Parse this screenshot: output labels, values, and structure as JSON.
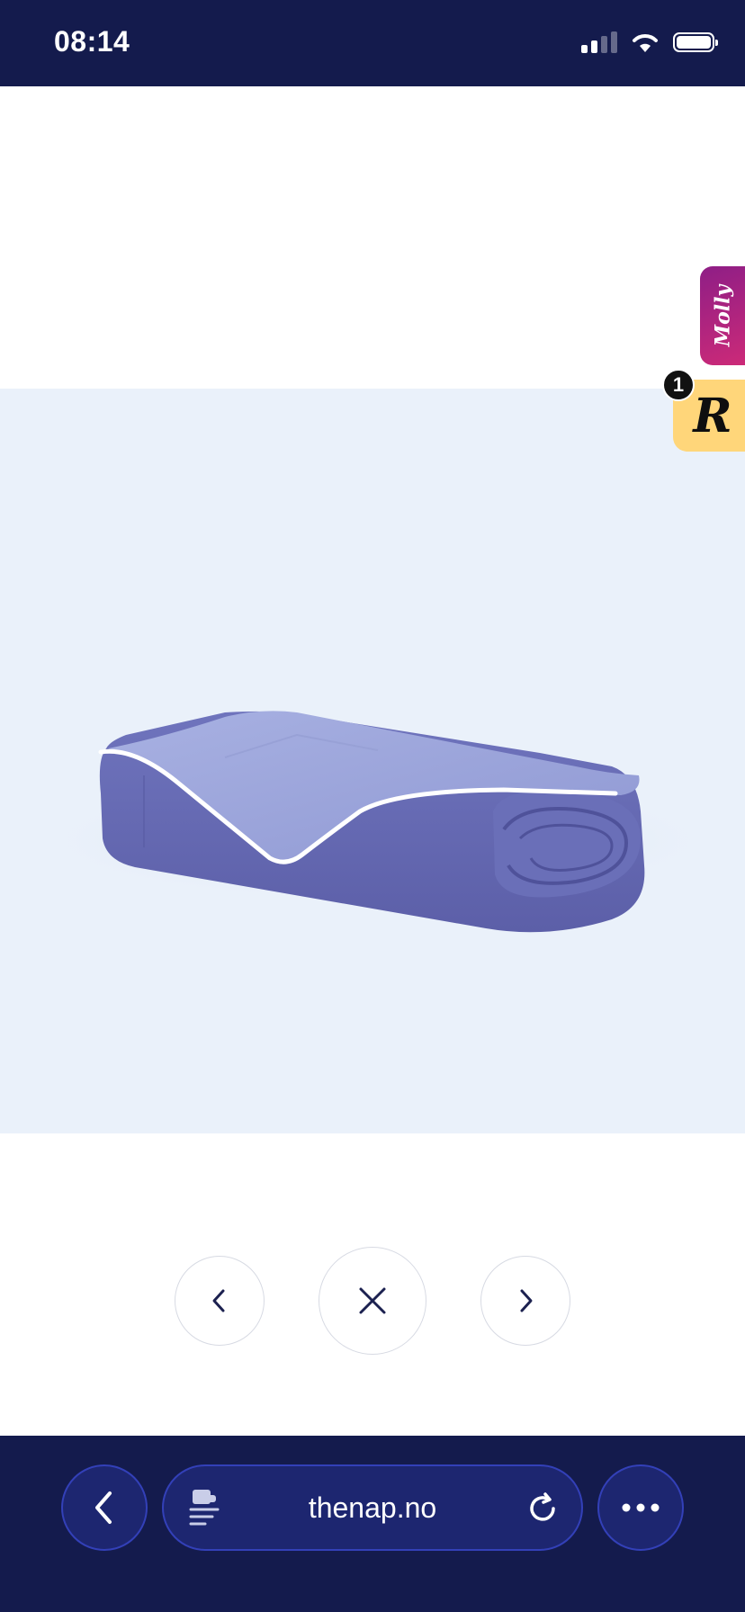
{
  "status_bar": {
    "time": "08:14"
  },
  "widgets": {
    "molly_label": "Molly",
    "r_letter": "R",
    "r_badge_count": "1"
  },
  "gallery": {
    "prev_icon": "chevron-left-icon",
    "close_icon": "close-icon",
    "next_icon": "chevron-right-icon"
  },
  "browser_bar": {
    "url": "thenap.no",
    "back_icon": "chevron-left-icon",
    "page_icon": "page-settings-icon",
    "reload_icon": "reload-icon",
    "more_icon": "more-icon"
  },
  "colors": {
    "navy": "#141b4d",
    "image_background": "#eaf1fa",
    "duvet_dark": "#6366b0",
    "duvet_light": "#9aa3d8",
    "molly_gradient_start": "#8e1e86",
    "r_widget_bg": "#ffd67a"
  }
}
